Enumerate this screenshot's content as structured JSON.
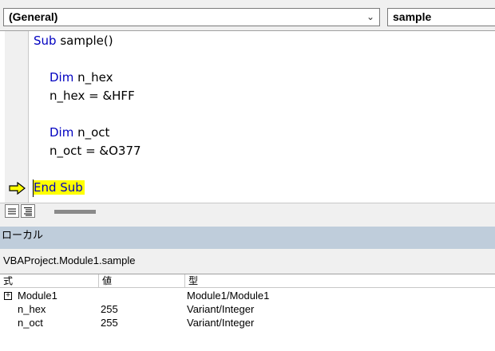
{
  "toolbar": {
    "object_combo": "(General)",
    "procedure_combo": "sample"
  },
  "code": {
    "lines": {
      "sub": "Sub",
      "sub_rest": " sample()",
      "dim1_kw": "Dim",
      "dim1_rest": " n_hex",
      "assign1": "n_hex = &HFF",
      "dim2_kw": "Dim",
      "dim2_rest": " n_oct",
      "assign2": "n_oct = &O377",
      "end_sub": "End Sub"
    },
    "keyword_color": "#0000c0",
    "highlight_color": "#ffff00"
  },
  "locals": {
    "title": "ローカル",
    "context": "VBAProject.Module1.sample",
    "headers": {
      "expr": "式",
      "value": "値",
      "type": "型"
    },
    "rows": [
      {
        "expr": "Module1",
        "value": "",
        "type": "Module1/Module1"
      },
      {
        "expr": "n_hex",
        "value": "255",
        "type": "Variant/Integer"
      },
      {
        "expr": "n_oct",
        "value": "255",
        "type": "Variant/Integer"
      }
    ]
  }
}
